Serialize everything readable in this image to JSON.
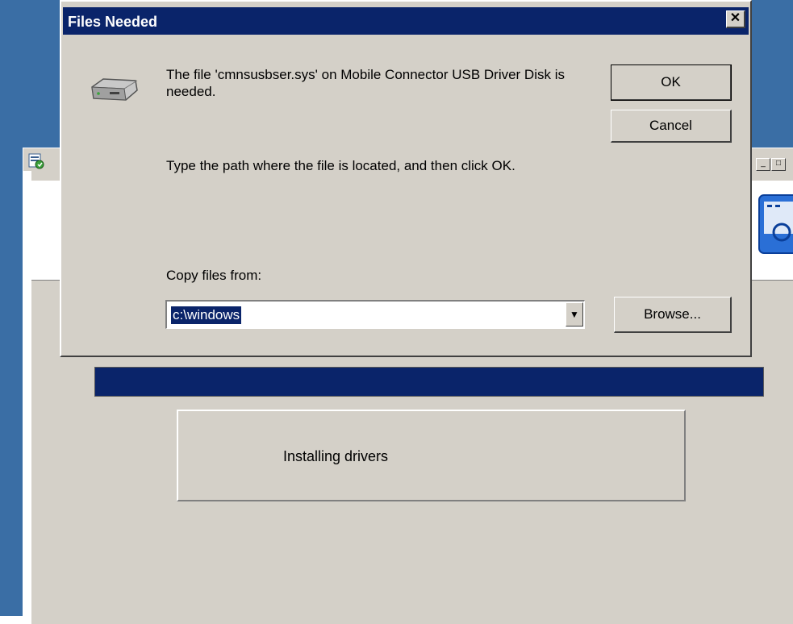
{
  "dialog": {
    "title": "Files Needed",
    "close_label": "✕",
    "message_line1": "The file 'cmnsusbser.sys' on Mobile Connector USB Driver Disk is needed.",
    "message_line2": "Type the path where the file is located, and then click OK.",
    "copy_from_label": "Copy files from:",
    "copy_from_value": "c:\\windows",
    "ok_label": "OK",
    "cancel_label": "Cancel",
    "browse_label": "Browse...",
    "dropdown_arrow": "▼",
    "icon": "disk-drive-icon"
  },
  "background_window": {
    "status_text": "Installing drivers",
    "minimize_label": "_",
    "maximize_label": "□",
    "app_icon": "installer-icon",
    "logo_icon": "app-logo-icon"
  },
  "colors": {
    "title_bar": "#0a246a",
    "face": "#d4d0c8",
    "desktop": "#3a6ea5"
  }
}
